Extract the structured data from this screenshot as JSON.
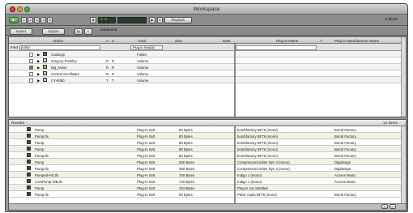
{
  "window": {
    "title": "Workspace",
    "items_count": "5 items"
  },
  "toolbar": {
    "lcd_text": "0.0",
    "playback_label": "Playback",
    "import_label": "Import",
    "export_label": "Export",
    "advanced_label": "Advanced"
  },
  "top_pane": {
    "columns": [
      "Name",
      "A",
      "V",
      "Kind",
      "Size",
      "Date",
      "Plug-in Name",
      "?",
      "Plug-in Manufacturer Name"
    ],
    "find_label": "Find",
    "find_value": "pump",
    "find_field": "Plug-in Set(All)",
    "rows": [
      {
        "checked": false,
        "name": "Catalogs",
        "a": "",
        "v": "",
        "kind": "Folder"
      },
      {
        "checked": false,
        "name": "Gregory Pockley",
        "a": "R",
        "v": "R",
        "kind": "Volume"
      },
      {
        "checked": true,
        "name": "Big_Noise",
        "a": "R",
        "v": "R",
        "kind": "Volume"
      },
      {
        "checked": false,
        "name": "Central Scrollware",
        "a": "R",
        "v": "R",
        "kind": "Volume"
      },
      {
        "checked": false,
        "name": "CY-8080",
        "a": "T",
        "v": "T",
        "kind": "Volume"
      }
    ]
  },
  "results": {
    "label": "Results",
    "count": "14 items",
    "rows": [
      {
        "name": "Pump",
        "kind": "Plug-In Sett",
        "size": "80 Bytes",
        "plugin": "bombfactory BF76 (mono)",
        "maker": "Bomb Factory"
      },
      {
        "name": "Pump.tfx",
        "kind": "Plug-In Sett",
        "size": "80 Bytes",
        "plugin": "bombfactory BF76 (mono)",
        "maker": "Bomb Factory"
      },
      {
        "name": "Pump",
        "kind": "Plug-In Sett",
        "size": "80 Bytes",
        "plugin": "bombfactory BF76 (mono)",
        "maker": "Bomb Factory"
      },
      {
        "name": "Pump",
        "kind": "Plug-In Sett",
        "size": "80 Bytes",
        "plugin": "bombfactory BF76 (mono)",
        "maker": "Bomb Factory"
      },
      {
        "name": "Pump.tfx",
        "kind": "Plug-In Sett",
        "size": "80 Bytes",
        "plugin": "bombfactory BF76 (mono)",
        "maker": "Bomb Factory"
      },
      {
        "name": "Pump",
        "kind": "Plug-In Sett",
        "size": "260 Bytes",
        "plugin": "Compressor/Limiter Dyn 3 (mono)",
        "maker": "Digidesign"
      },
      {
        "name": "Pump.tfx",
        "kind": "Plug-In Sett",
        "size": "260 Bytes",
        "plugin": "Compressor/Limiter Dyn 3 (mono)",
        "maker": "Digidesign"
      },
      {
        "name": "Pumped-HS.tfx",
        "kind": "Plug-In Sett",
        "size": "720 Bytes",
        "plugin": "Indigo 1 (mono)",
        "maker": "Access Music"
      },
      {
        "name": "ComPump-WB.tfx",
        "kind": "Plug-In Sett",
        "size": "720 Bytes",
        "plugin": "Indigo 1 (mono)",
        "maker": "Access Music"
      },
      {
        "name": "Pump",
        "kind": "Plug-In Sett",
        "size": "104 Bytes",
        "plugin": "Plug-in not installed",
        "maker": ""
      },
      {
        "name": "Pump.tfx",
        "kind": "Plug-In Sett",
        "size": "80 Bytes",
        "plugin": "Pulse Audio BF76 (mono)",
        "maker": "Bomb Factory"
      }
    ]
  }
}
